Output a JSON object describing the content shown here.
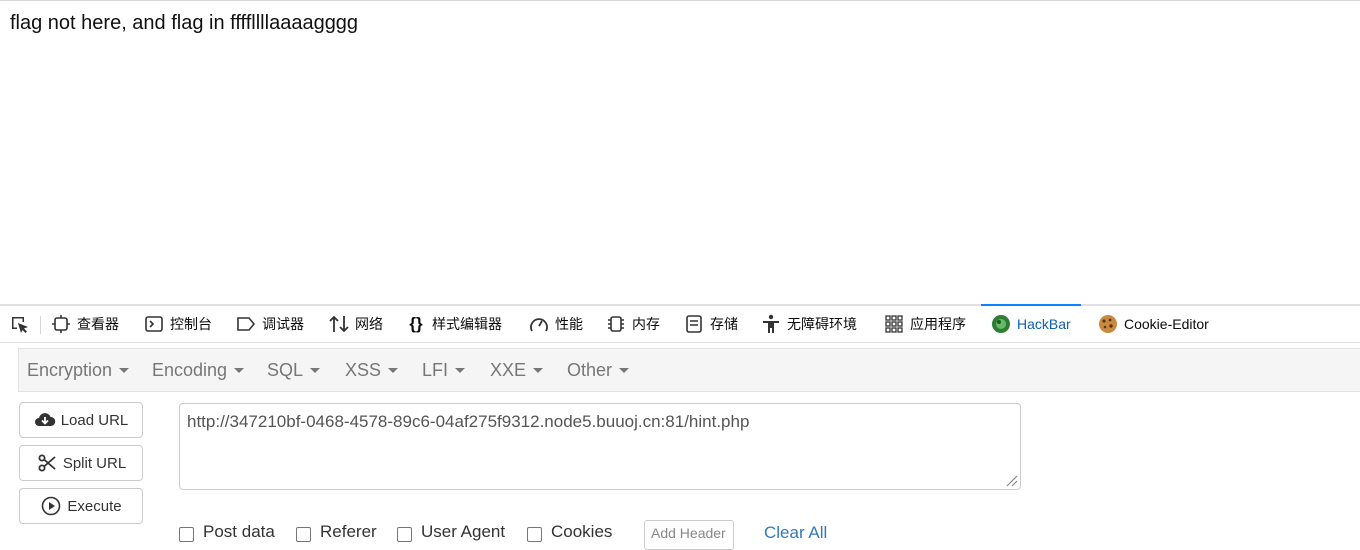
{
  "page": {
    "message": "flag not here, and flag in ffffllllaaaagggg"
  },
  "devtools": {
    "tabs": [
      {
        "label": "查看器",
        "icon": "inspector-icon"
      },
      {
        "label": "控制台",
        "icon": "console-icon"
      },
      {
        "label": "调试器",
        "icon": "debugger-icon"
      },
      {
        "label": "网络",
        "icon": "network-icon"
      },
      {
        "label": "样式编辑器",
        "icon": "style-editor-icon"
      },
      {
        "label": "性能",
        "icon": "performance-icon"
      },
      {
        "label": "内存",
        "icon": "memory-icon"
      },
      {
        "label": "存储",
        "icon": "storage-icon"
      },
      {
        "label": "无障碍环境",
        "icon": "accessibility-icon"
      },
      {
        "label": "应用程序",
        "icon": "application-icon"
      },
      {
        "label": "HackBar",
        "icon": "hackbar-icon",
        "selected": true
      },
      {
        "label": "Cookie-Editor",
        "icon": "cookie-icon"
      }
    ],
    "accent_color": "#0a84ff"
  },
  "hackbar": {
    "menu": [
      "Encryption",
      "Encoding",
      "SQL",
      "XSS",
      "LFI",
      "XXE",
      "Other"
    ],
    "buttons": {
      "load": "Load URL",
      "split": "Split URL",
      "execute": "Execute"
    },
    "url": "http://347210bf-0468-4578-89c6-04af275f9312.node5.buuoj.cn:81/hint.php",
    "options": [
      "Post data",
      "Referer",
      "User Agent",
      "Cookies"
    ],
    "add_header_placeholder": "Add Header",
    "clear_all": "Clear All"
  }
}
